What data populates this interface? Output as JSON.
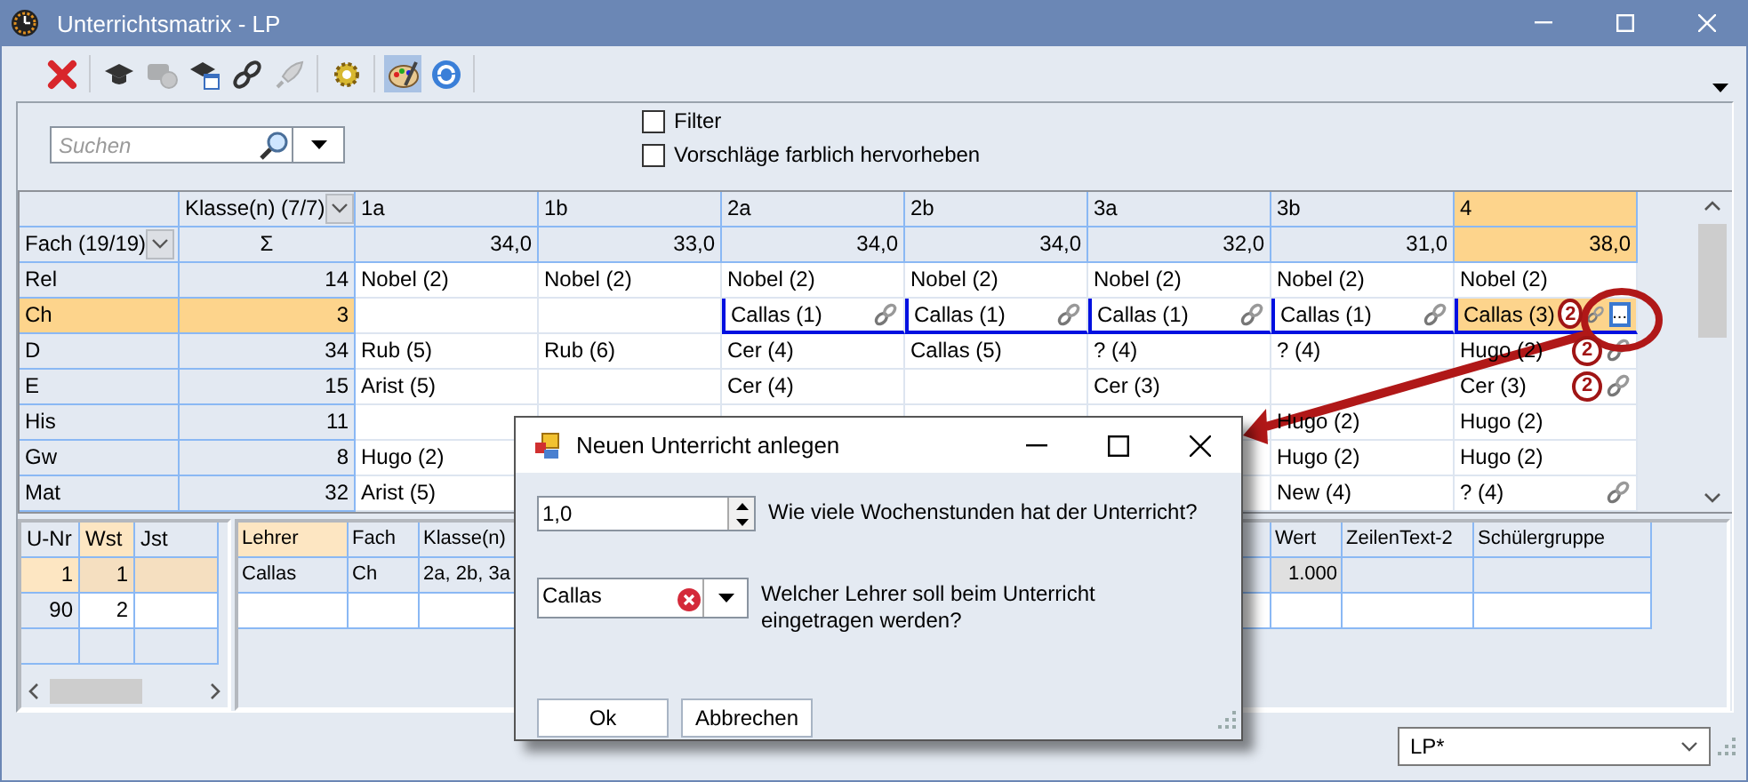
{
  "window": {
    "title": "Unterrichtsmatrix - LP"
  },
  "toolbar": [
    {
      "items": [
        {
          "kind": "delete",
          "disabled": false,
          "selected": false
        }
      ]
    },
    {
      "items": [
        {
          "kind": "cap",
          "disabled": false,
          "selected": false
        },
        {
          "kind": "chat",
          "disabled": true,
          "selected": false
        },
        {
          "kind": "cap-calendar",
          "disabled": false,
          "selected": false
        },
        {
          "kind": "link",
          "disabled": false,
          "selected": false
        },
        {
          "kind": "rocket",
          "disabled": true,
          "selected": false
        }
      ]
    },
    {
      "items": [
        {
          "kind": "gear",
          "disabled": false,
          "selected": false
        }
      ]
    },
    {
      "items": [
        {
          "kind": "palette",
          "disabled": false,
          "selected": true
        },
        {
          "kind": "refresh",
          "disabled": false,
          "selected": false
        }
      ]
    }
  ],
  "search": {
    "placeholder": "Suchen"
  },
  "options": [
    {
      "label": "Filter",
      "checked": false
    },
    {
      "label": "Vorschläge farblich hervorheben",
      "checked": false
    }
  ],
  "matrix": {
    "class_filter": "Klasse(n) (7/7)",
    "subject_filter": "Fach (19/19)",
    "sum_symbol": "Σ",
    "columns": [
      {
        "name": "1a",
        "total": "34,0",
        "selected": false
      },
      {
        "name": "1b",
        "total": "33,0",
        "selected": false
      },
      {
        "name": "2a",
        "total": "34,0",
        "selected": false
      },
      {
        "name": "2b",
        "total": "34,0",
        "selected": false
      },
      {
        "name": "3a",
        "total": "32,0",
        "selected": false
      },
      {
        "name": "3b",
        "total": "31,0",
        "selected": false
      },
      {
        "name": "4",
        "total": "38,0",
        "selected": true
      }
    ],
    "rows": [
      {
        "subject": "Rel",
        "total": "14",
        "selected": false,
        "cells": [
          {
            "text": "Nobel (2)"
          },
          {
            "text": "Nobel (2)"
          },
          {
            "text": "Nobel (2)"
          },
          {
            "text": "Nobel (2)"
          },
          {
            "text": "Nobel (2)"
          },
          {
            "text": "Nobel (2)"
          },
          {
            "text": "Nobel (2)"
          }
        ]
      },
      {
        "subject": "Ch",
        "total": "3",
        "selected": true,
        "cells": [
          {
            "marked": false
          },
          {
            "marked": false
          },
          {
            "text": "Callas (1)",
            "link": true,
            "marked": true
          },
          {
            "text": "Callas (1)",
            "link": true,
            "marked": true
          },
          {
            "text": "Callas (1)",
            "link": true,
            "marked": true
          },
          {
            "text": "Callas (1)",
            "link": true,
            "marked": true
          },
          {
            "text": "Callas (3)",
            "badge": "2",
            "link": true,
            "marked": true,
            "button": "..."
          }
        ]
      },
      {
        "subject": "D",
        "total": "34",
        "selected": false,
        "cells": [
          {
            "text": "Rub (5)"
          },
          {
            "text": "Rub (6)"
          },
          {
            "text": "Cer (4)"
          },
          {
            "text": "Callas (5)"
          },
          {
            "text": "? (4)"
          },
          {
            "text": "? (4)"
          },
          {
            "text": "Hugo (2)",
            "badge": "2",
            "link": true
          }
        ]
      },
      {
        "subject": "E",
        "total": "15",
        "selected": false,
        "cells": [
          {
            "text": "Arist (5)"
          },
          {},
          {
            "text": "Cer (4)"
          },
          {},
          {
            "text": "Cer (3)"
          },
          {},
          {
            "text": "Cer (3)",
            "badge": "2",
            "link": true
          }
        ]
      },
      {
        "subject": "His",
        "total": "11",
        "selected": false,
        "cells": [
          {},
          {},
          {},
          {},
          {},
          {
            "text": "Hugo (2)"
          },
          {
            "text": "Hugo (2)"
          }
        ]
      },
      {
        "subject": "Gw",
        "total": "8",
        "selected": false,
        "cells": [
          {
            "text": "Hugo (2)"
          },
          {},
          {},
          {},
          {},
          {
            "text": "Hugo (2)"
          },
          {
            "text": "Hugo (2)"
          }
        ]
      },
      {
        "subject": "Mat",
        "total": "32",
        "selected": false,
        "cells": [
          {
            "text": "Arist (5)"
          },
          {},
          {},
          {},
          {},
          {
            "text": "New (4)"
          },
          {
            "text": "? (4)",
            "link": true
          }
        ]
      }
    ]
  },
  "lessons": {
    "columns": [
      {
        "label": "U-Nr",
        "selected": false
      },
      {
        "label": "Wst",
        "selected": true
      },
      {
        "label": "Jst",
        "selected": false
      }
    ],
    "rows": [
      {
        "number": "1",
        "hours": "1",
        "selected": true
      },
      {
        "number": "90",
        "hours": "2",
        "selected": false
      }
    ]
  },
  "teachers": {
    "columns": [
      {
        "label": "Lehrer",
        "selected": true
      },
      {
        "label": "Fach",
        "selected": false
      },
      {
        "label": "Klasse(n)",
        "selected": false
      },
      {
        "label": "Wert",
        "selected": false
      },
      {
        "label": "ZeilenText-2",
        "selected": false
      },
      {
        "label": "Schülergruppe",
        "selected": false
      }
    ],
    "rows": [
      {
        "teacher": "Callas",
        "subject": "Ch",
        "classes": "2a, 2b, 3a",
        "value": "1.000"
      }
    ]
  },
  "profile": {
    "value": "LP*"
  },
  "dialog": {
    "title": "Neuen Unterricht anlegen",
    "hours": {
      "value": "1,0",
      "label": "Wie viele Wochenstunden hat der Unterricht?"
    },
    "teacher": {
      "value": "Callas",
      "label": "Welcher Lehrer soll beim Unterricht eingetragen werden?"
    },
    "buttons": [
      "Ok",
      "Abbrechen"
    ]
  }
}
